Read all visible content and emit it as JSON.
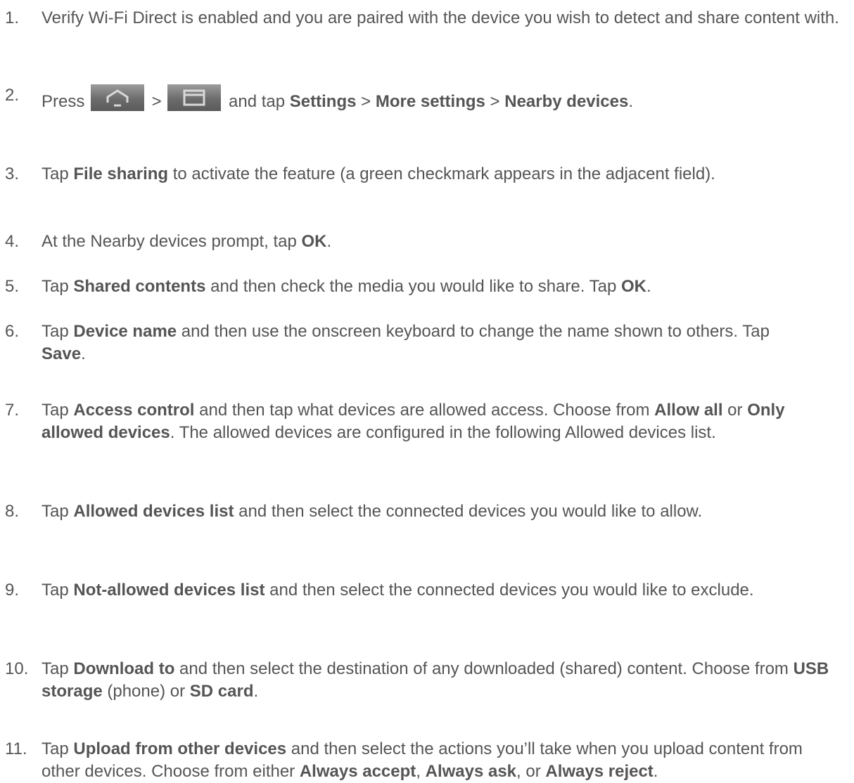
{
  "steps": [
    {
      "number": "1.",
      "segments": [
        {
          "text": "Verify Wi-Fi Direct is enabled and you are paired with the device you wish to detect and share content with."
        }
      ]
    },
    {
      "number": "2.",
      "segments": [
        {
          "text": "Press "
        },
        {
          "icon": "home-key-icon"
        },
        {
          "text": " > "
        },
        {
          "icon": "menu-key-icon"
        },
        {
          "text": " and tap "
        },
        {
          "text": "Settings",
          "bold": true
        },
        {
          "text": " > "
        },
        {
          "text": "More settings",
          "bold": true
        },
        {
          "text": " > "
        },
        {
          "text": "Nearby devices",
          "bold": true
        },
        {
          "text": "."
        }
      ]
    },
    {
      "number": "3.",
      "segments": [
        {
          "text": "Tap "
        },
        {
          "text": "File sharing",
          "bold": true
        },
        {
          "text": " to activate the feature (a green checkmark appears in the adjacent field)."
        }
      ]
    },
    {
      "number": "4.",
      "segments": [
        {
          "text": "At the Nearby devices prompt, tap "
        },
        {
          "text": "OK",
          "bold": true
        },
        {
          "text": "."
        }
      ]
    },
    {
      "number": "5.",
      "segments": [
        {
          "text": "Tap "
        },
        {
          "text": "Shared contents",
          "bold": true
        },
        {
          "text": " and then check the media you would like to share. Tap "
        },
        {
          "text": "OK",
          "bold": true
        },
        {
          "text": "."
        }
      ]
    },
    {
      "number": "6.",
      "segments": [
        {
          "text": "Tap "
        },
        {
          "text": "Device name",
          "bold": true
        },
        {
          "text": " and then use the onscreen keyboard to change the name shown to others. Tap "
        },
        {
          "text": "Save",
          "bold": true
        },
        {
          "text": "."
        }
      ]
    },
    {
      "number": "7.",
      "segments": [
        {
          "text": "Tap "
        },
        {
          "text": "Access control",
          "bold": true
        },
        {
          "text": " and then tap what devices are allowed access. Choose from "
        },
        {
          "text": "Allow all",
          "bold": true
        },
        {
          "text": " or "
        },
        {
          "text": "Only allowed devices",
          "bold": true
        },
        {
          "text": ". The allowed devices are configured in the following Allowed devices list."
        }
      ]
    },
    {
      "number": "8.",
      "segments": [
        {
          "text": "Tap "
        },
        {
          "text": "Allowed devices list",
          "bold": true
        },
        {
          "text": " and then select the connected devices you would like to allow."
        }
      ]
    },
    {
      "number": "9.",
      "segments": [
        {
          "text": "Tap "
        },
        {
          "text": "Not-allowed devices list",
          "bold": true
        },
        {
          "text": " and then select the connected devices you would like to exclude."
        }
      ]
    },
    {
      "number": "10.",
      "segments": [
        {
          "text": "Tap "
        },
        {
          "text": "Download to",
          "bold": true
        },
        {
          "text": " and then select the destination of any downloaded (shared) content. Choose from "
        },
        {
          "text": "USB storage",
          "bold": true
        },
        {
          "text": " (phone) or "
        },
        {
          "text": "SD card",
          "bold": true
        },
        {
          "text": "."
        }
      ]
    },
    {
      "number": "11.",
      "segments": [
        {
          "text": "Tap "
        },
        {
          "text": "Upload from other devices",
          "bold": true
        },
        {
          "text": " and then select the actions you’ll take when you upload content from other devices. Choose from either "
        },
        {
          "text": "Always accept",
          "bold": true
        },
        {
          "text": ", "
        },
        {
          "text": "Always ask",
          "bold": true
        },
        {
          "text": ", or "
        },
        {
          "text": "Always reject",
          "bold": true
        },
        {
          "text": "."
        }
      ]
    }
  ],
  "colors": {
    "text": "#555555",
    "key_gradient_top": "#9c9c9c",
    "key_gradient_bottom": "#5a5a5a",
    "key_glyph": "#d8d8d8"
  }
}
